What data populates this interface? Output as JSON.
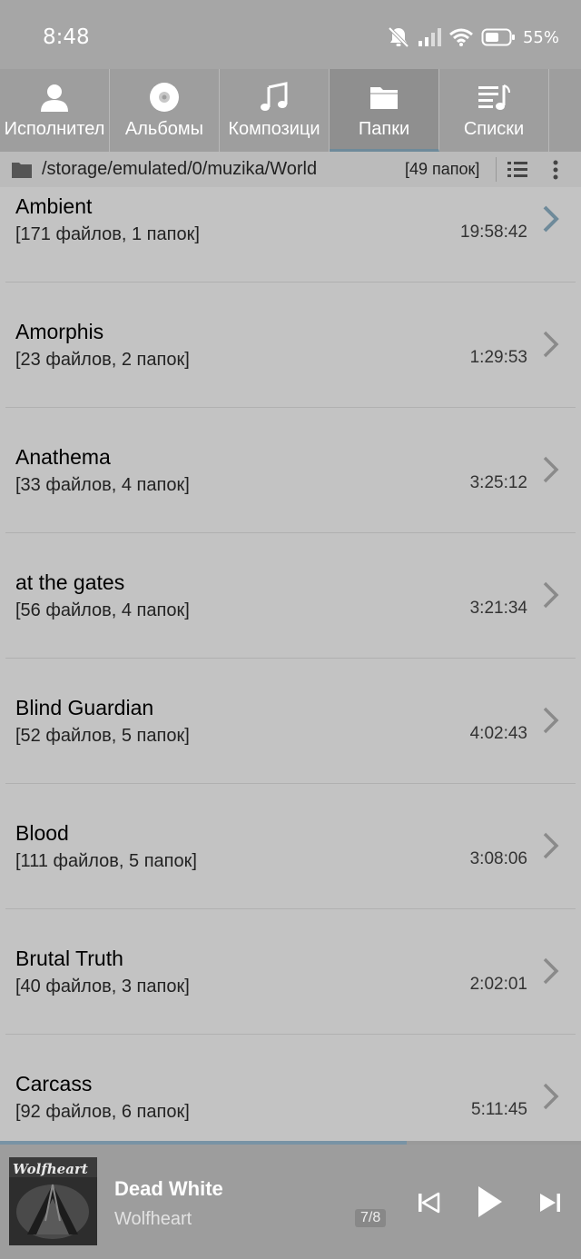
{
  "status_bar": {
    "time": "8:48",
    "battery_percent": "55%",
    "icons": [
      "bell-off-icon",
      "cellular-signal-icon",
      "wifi-icon",
      "battery-icon"
    ]
  },
  "tabs": [
    {
      "label": "Исполнител",
      "icon": "person-icon",
      "active": false
    },
    {
      "label": "Альбомы",
      "icon": "disc-icon",
      "active": false
    },
    {
      "label": "Композици",
      "icon": "music-note-icon",
      "active": false
    },
    {
      "label": "Папки",
      "icon": "folder-icon",
      "active": true
    },
    {
      "label": "Списки",
      "icon": "playlist-icon",
      "active": false
    }
  ],
  "path_bar": {
    "path": "/storage/emulated/0/muzika/World",
    "count": "[49 папок]"
  },
  "folders": [
    {
      "name": "Ambient",
      "info": "[171 файлов, 1 папок]",
      "duration": "19:58:42",
      "highlighted": true
    },
    {
      "name": "Amorphis",
      "info": "[23 файлов, 2 папок]",
      "duration": "1:29:53",
      "highlighted": false
    },
    {
      "name": "Anathema",
      "info": "[33 файлов, 4 папок]",
      "duration": "3:25:12",
      "highlighted": false
    },
    {
      "name": "at the gates",
      "info": "[56 файлов, 4 папок]",
      "duration": "3:21:34",
      "highlighted": false
    },
    {
      "name": "Blind Guardian",
      "info": "[52 файлов, 5 папок]",
      "duration": "4:02:43",
      "highlighted": false
    },
    {
      "name": "Blood",
      "info": "[111 файлов, 5 папок]",
      "duration": "3:08:06",
      "highlighted": false
    },
    {
      "name": "Brutal Truth",
      "info": "[40 файлов, 3 папок]",
      "duration": "2:02:01",
      "highlighted": false
    },
    {
      "name": "Carcass",
      "info": "[92 файлов, 6 папок]",
      "duration": "5:11:45",
      "highlighted": false
    }
  ],
  "player": {
    "title": "Dead White",
    "artist": "Wolfheart",
    "position": "7/8",
    "art_logo_text": "Wolfheart",
    "progress_fraction": 0.7
  },
  "colors": {
    "accent": "#7893a5",
    "background": "#c3c3c3",
    "tab_bar": "#a0a0a0",
    "player_bar": "#9d9d9d"
  }
}
